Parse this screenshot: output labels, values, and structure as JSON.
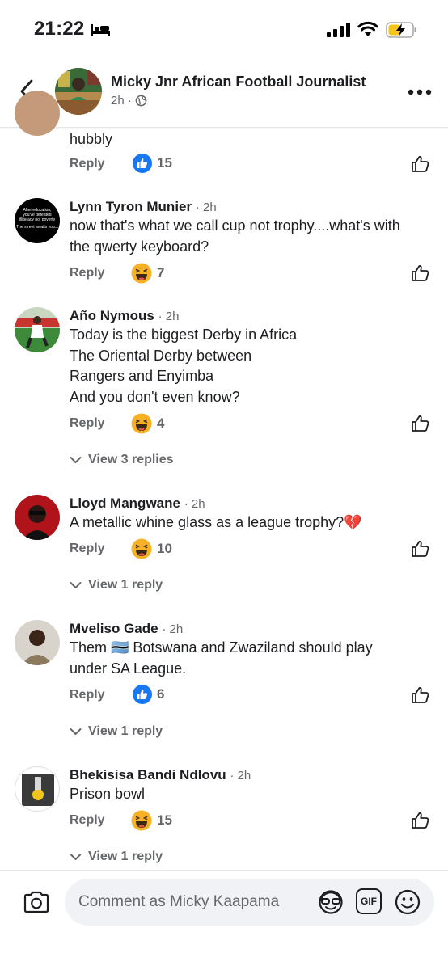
{
  "status_bar": {
    "time": "21:22"
  },
  "header": {
    "title": "Micky Jnr African Football Journalist",
    "time": "2h",
    "separator": "·"
  },
  "comments": [
    {
      "name": "",
      "time": "",
      "text": [
        "hubbly"
      ],
      "reply_label": "Reply",
      "reaction": "like",
      "reaction_count": "15",
      "view_replies": ""
    },
    {
      "name": "Lynn Tyron Munier",
      "time": "· 2h",
      "text": [
        "now that's what we call cup not trophy....what's with",
        "the qwerty keyboard?"
      ],
      "reply_label": "Reply",
      "reaction": "haha",
      "reaction_count": "7",
      "view_replies": ""
    },
    {
      "name": "Año Nymous",
      "time": "· 2h",
      "text": [
        "Today is the biggest Derby in Africa",
        "The Oriental Derby between",
        "Rangers and Enyimba",
        "And you don't even know?"
      ],
      "reply_label": "Reply",
      "reaction": "haha",
      "reaction_count": "4",
      "view_replies": "View 3 replies"
    },
    {
      "name": "Lloyd Mangwane",
      "time": "· 2h",
      "text": [
        "A metallic whine glass as a league trophy?💔"
      ],
      "reply_label": "Reply",
      "reaction": "haha",
      "reaction_count": "10",
      "view_replies": "View 1 reply"
    },
    {
      "name": "Mveliso Gade",
      "time": "· 2h",
      "text": [
        "Them 🇧🇼 Botswana and Zwaziland should play",
        "under SA League."
      ],
      "reply_label": "Reply",
      "reaction": "like",
      "reaction_count": "6",
      "view_replies": "View 1 reply"
    },
    {
      "name": "Bhekisisa Bandi Ndlovu",
      "time": "· 2h",
      "text": [
        "Prison bowl"
      ],
      "reply_label": "Reply",
      "reaction": "haha",
      "reaction_count": "15",
      "view_replies": "View 1 reply"
    }
  ],
  "avatar_text": {
    "lynn_line1": "After education, you've defeated illiteracy not poverty",
    "lynn_line2": "The street awaits you..."
  },
  "composer": {
    "placeholder": "Comment as Micky Kaapama",
    "gif_label": "GIF"
  },
  "colors": {
    "accent_blue": "#1877f2",
    "haha_yellow": "#f7b125",
    "secondary_text": "#65676b",
    "input_bg": "#f0f2f5"
  }
}
